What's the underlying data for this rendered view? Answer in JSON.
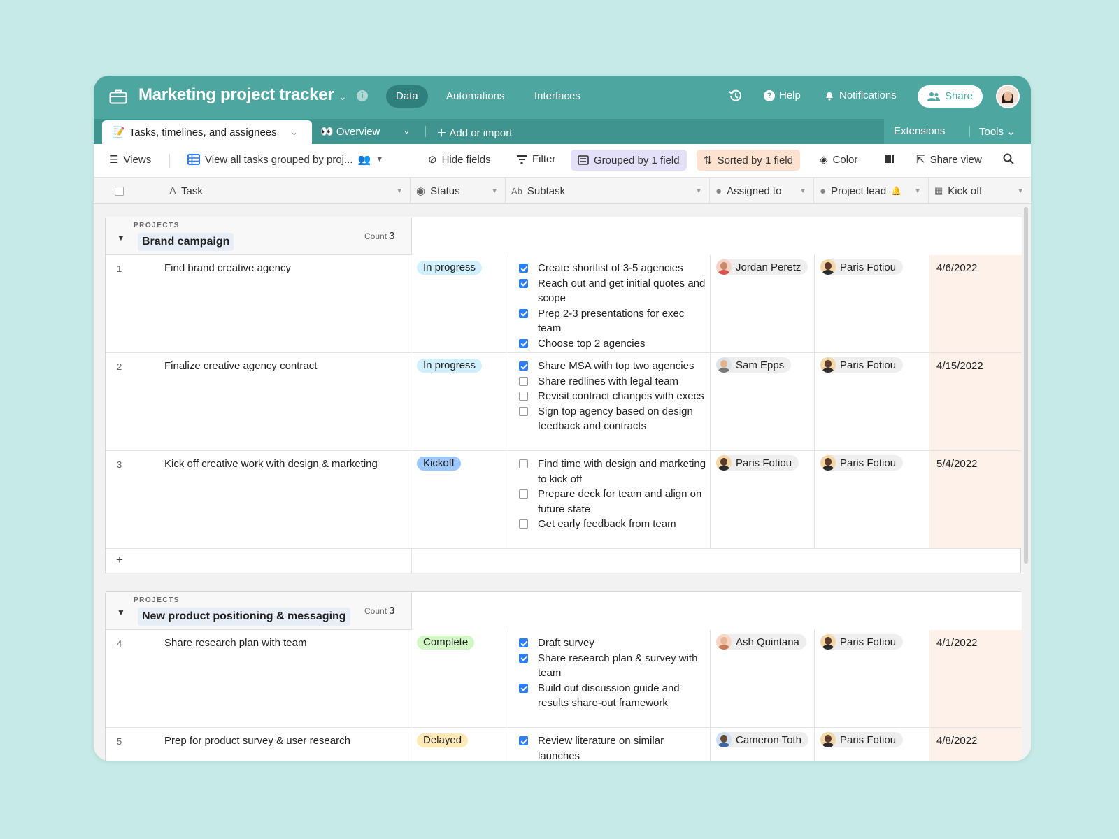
{
  "app": {
    "title": "Marketing project tracker",
    "nav": [
      "Data",
      "Automations",
      "Interfaces"
    ],
    "help_label": "Help",
    "notifications_label": "Notifications",
    "share_label": "Share"
  },
  "tabs": {
    "active_emoji": "📝",
    "active": "Tasks, timelines, and assignees",
    "overview_emoji": "👀",
    "overview": "Overview",
    "add_label": "Add or import",
    "extensions_label": "Extensions",
    "tools_label": "Tools"
  },
  "viewbar": {
    "views_label": "Views",
    "view_name": "View all tasks grouped by proj...",
    "hide_fields_label": "Hide fields",
    "filter_label": "Filter",
    "grouped_label": "Grouped by 1 field",
    "sorted_label": "Sorted by 1 field",
    "color_label": "Color",
    "share_view_label": "Share view"
  },
  "columns": {
    "task": "Task",
    "status": "Status",
    "subtask": "Subtask",
    "assigned": "Assigned to",
    "lead": "Project lead",
    "kickoff": "Kick off"
  },
  "groups": [
    {
      "label": "PROJECTS",
      "name": "Brand campaign",
      "count_label": "Count",
      "count": "3",
      "rows": [
        {
          "num": "1",
          "task": "Find brand creative agency",
          "status": "In progress",
          "subtasks": [
            {
              "text": "Create shortlist of 3-5 agencies",
              "done": true
            },
            {
              "text": "Reach out and get initial quotes and scope",
              "done": true
            },
            {
              "text": "Prep 2-3 presentations for exec team",
              "done": true
            },
            {
              "text": "Choose top 2 agencies",
              "done": true
            }
          ],
          "assigned": "Jordan Peretz",
          "lead": "Paris Fotiou",
          "kickoff": "4/6/2022"
        },
        {
          "num": "2",
          "task": "Finalize creative agency contract",
          "status": "In progress",
          "subtasks": [
            {
              "text": "Share MSA with top two agencies",
              "done": true
            },
            {
              "text": "Share redlines with legal team",
              "done": false
            },
            {
              "text": "Revisit contract changes with execs",
              "done": false
            },
            {
              "text": "Sign top agency based on design feedback and contracts",
              "done": false
            }
          ],
          "assigned": "Sam Epps",
          "lead": "Paris Fotiou",
          "kickoff": "4/15/2022"
        },
        {
          "num": "3",
          "task": "Kick off creative work with design & marketing",
          "status": "Kickoff",
          "subtasks": [
            {
              "text": "Find time with design and marketing to kick off",
              "done": false
            },
            {
              "text": "Prepare deck for team and align on future state",
              "done": false
            },
            {
              "text": "Get early feedback from team",
              "done": false
            }
          ],
          "assigned": "Paris Fotiou",
          "lead": "Paris Fotiou",
          "kickoff": "5/4/2022"
        }
      ]
    },
    {
      "label": "PROJECTS",
      "name": "New product positioning & messaging",
      "count_label": "Count",
      "count": "3",
      "rows": [
        {
          "num": "4",
          "task": "Share research plan with team",
          "status": "Complete",
          "subtasks": [
            {
              "text": "Draft survey",
              "done": true
            },
            {
              "text": "Share research plan & survey with team",
              "done": true
            },
            {
              "text": "Build out discussion guide and results share-out framework",
              "done": true
            }
          ],
          "assigned": "Ash Quintana",
          "lead": "Paris Fotiou",
          "kickoff": "4/1/2022"
        },
        {
          "num": "5",
          "task": "Prep for product survey & user research",
          "status": "Delayed",
          "subtasks": [
            {
              "text": "Review literature on similar launches",
              "done": true
            }
          ],
          "assigned": "Cameron Toth",
          "lead": "Paris Fotiou",
          "kickoff": "4/8/2022"
        }
      ]
    }
  ],
  "status_colors": {
    "In progress": "#d0f0fd",
    "Kickoff": "#9cc7ff",
    "Complete": "#d1f7c4",
    "Delayed": "#ffeab6"
  },
  "people_colors": {
    "Jordan Peretz": [
      "#c98a6a",
      "#d9534f"
    ],
    "Sam Epps": [
      "#e2b48d",
      "#777777"
    ],
    "Paris Fotiou": [
      "#5b3a29",
      "#2b2b2b"
    ],
    "Ash Quintana": [
      "#e6b899",
      "#c47a55"
    ],
    "Cameron Toth": [
      "#6b4a33",
      "#3c6aa0"
    ]
  }
}
